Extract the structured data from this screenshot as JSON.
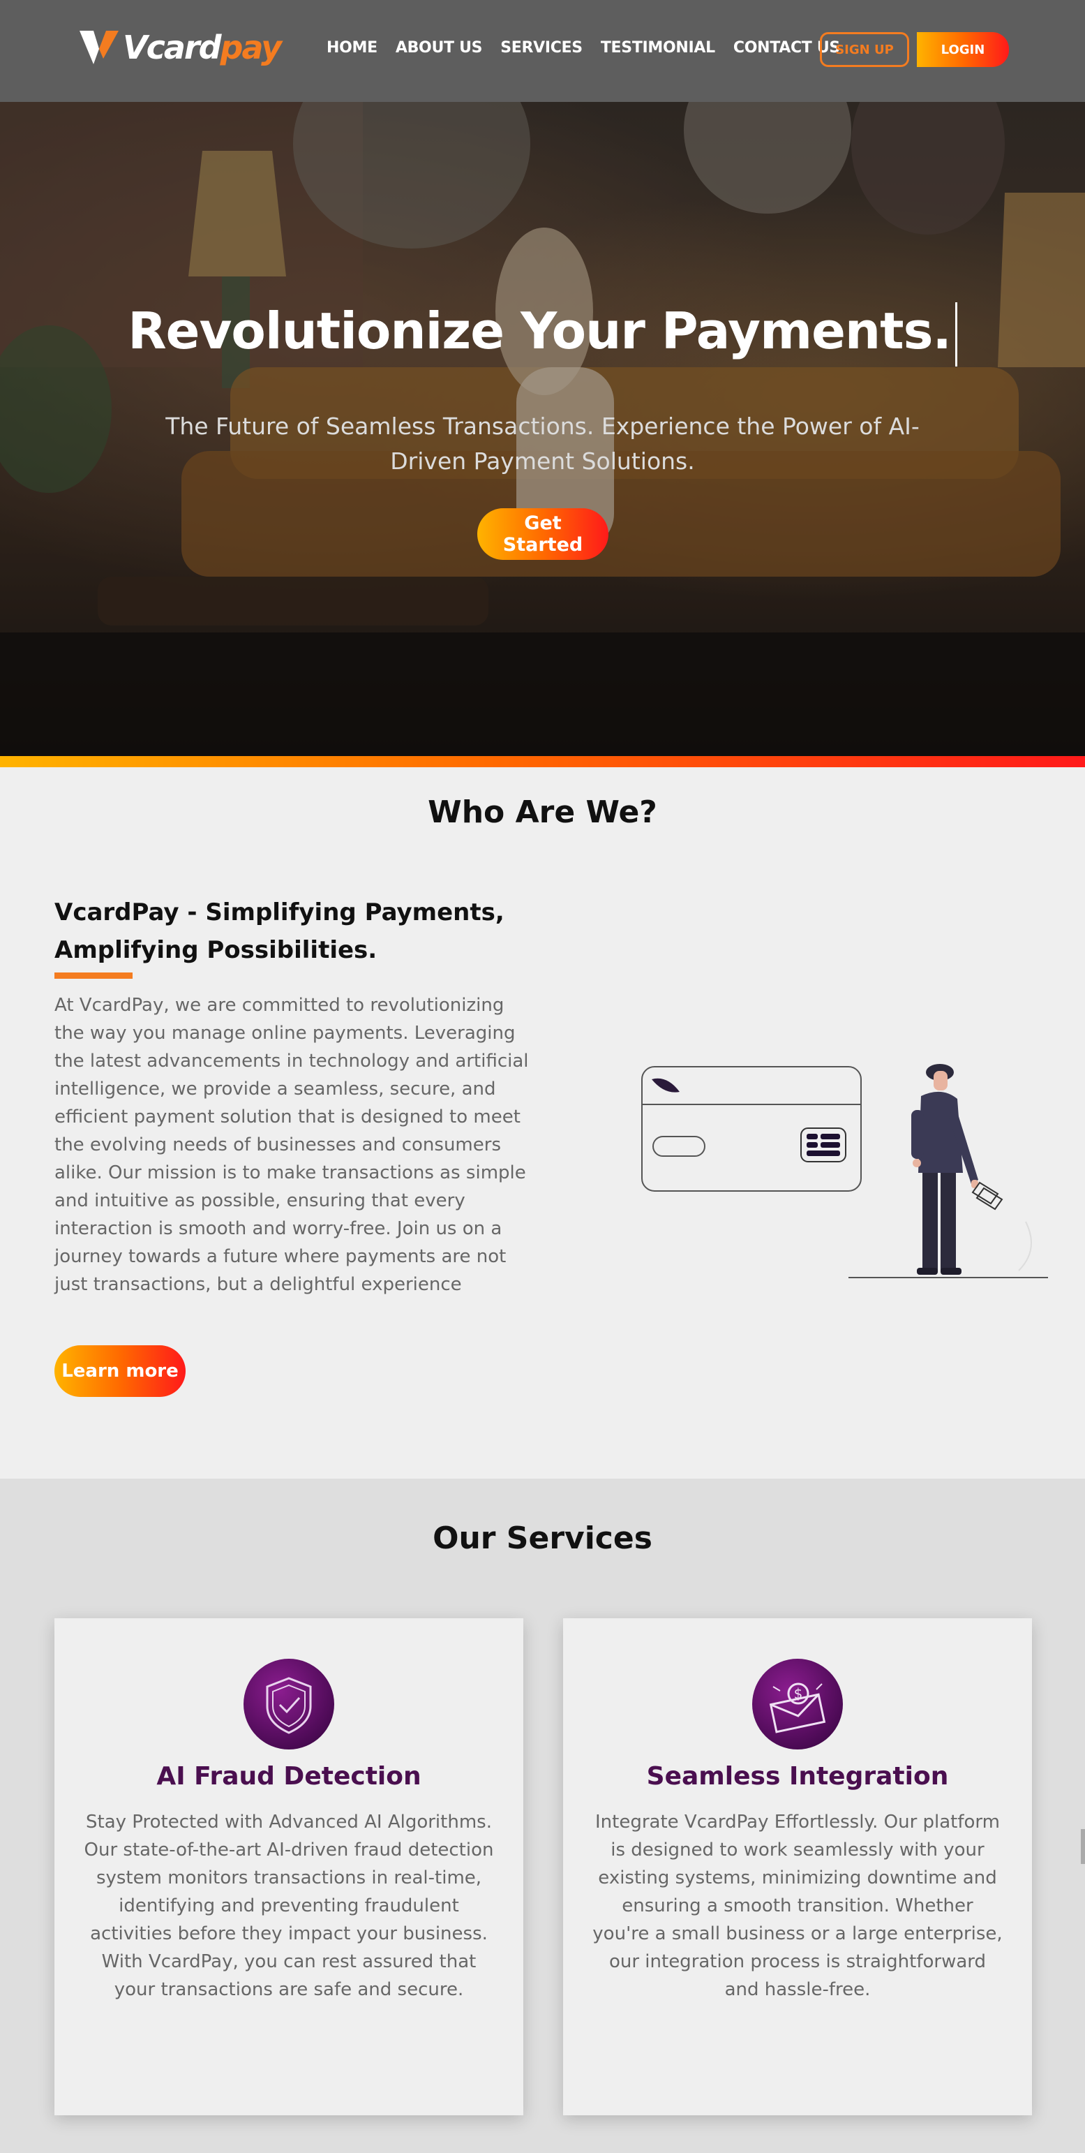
{
  "nav": {
    "logo": {
      "part1": "Vcard",
      "part2": "pay"
    },
    "items": [
      {
        "label": "HOME"
      },
      {
        "label": "ABOUT US"
      },
      {
        "label": "SERVICES"
      },
      {
        "label": "TESTIMONIAL"
      },
      {
        "label": "CONTACT US"
      }
    ],
    "signup_label": "SIGN UP",
    "login_label": "LOGIN"
  },
  "hero": {
    "title": "Revolutionize Your Payments.",
    "subtitle": "The Future of Seamless Transactions. Experience the Power of AI-Driven Payment Solutions.",
    "cta_label": "Get Started"
  },
  "about": {
    "section_title": "Who Are We?",
    "heading": "VcardPay - Simplifying Payments, Amplifying Possibilities.",
    "body": "At VcardPay, we are committed to revolutionizing the way you manage online payments. Leveraging the latest advancements in technology and artificial intelligence, we provide a seamless, secure, and efficient payment solution that is designed to meet the evolving needs of businesses and consumers alike. Our mission is to make transactions as simple and intuitive as possible, ensuring that every interaction is smooth and worry-free. Join us on a journey towards a future where payments are not just transactions, but a delightful experience",
    "cta_label": "Learn more"
  },
  "services": {
    "section_title": "Our Services",
    "cards": [
      {
        "icon": "shield-check-icon",
        "title": "AI Fraud Detection",
        "body": "Stay Protected with Advanced AI Algorithms. Our state-of-the-art AI-driven fraud detection system monitors transactions in real-time, identifying and preventing fraudulent activities before they impact your business. With VcardPay, you can rest assured that your transactions are safe and secure."
      },
      {
        "icon": "money-envelope-icon",
        "title": "Seamless Integration",
        "body": "Integrate VcardPay Effortlessly. Our platform is designed to work seamlessly with your existing systems, minimizing downtime and ensuring a smooth transition. Whether you're a small business or a large enterprise, our integration process is straightforward and hassle-free."
      }
    ]
  },
  "colors": {
    "accent": "#f47c20",
    "gradient_start": "#ffb300",
    "gradient_end": "#ff1a1a",
    "service_title": "#4a0f4f",
    "nav_bg": "#5e5e5e"
  }
}
